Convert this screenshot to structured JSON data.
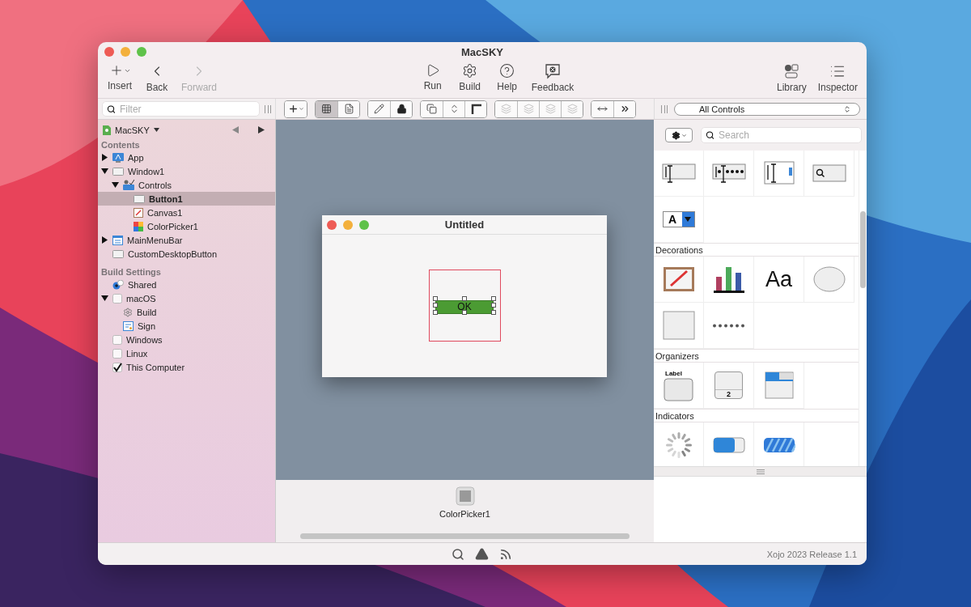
{
  "window": {
    "title": "MacSKY"
  },
  "toolbar": {
    "left": [
      {
        "kind": "insert",
        "label": "Insert",
        "disabled": false
      },
      {
        "kind": "back",
        "label": "Back",
        "disabled": false
      },
      {
        "kind": "forward",
        "label": "Forward",
        "disabled": true
      }
    ],
    "center": [
      {
        "kind": "run",
        "label": "Run",
        "disabled": false
      },
      {
        "kind": "build",
        "label": "Build",
        "disabled": false
      },
      {
        "kind": "help",
        "label": "Help",
        "disabled": false
      },
      {
        "kind": "feedback",
        "label": "Feedback",
        "disabled": false
      }
    ],
    "right": [
      {
        "kind": "library",
        "label": "Library",
        "disabled": false
      },
      {
        "kind": "inspector",
        "label": "Inspector",
        "disabled": false
      }
    ]
  },
  "filter": {
    "placeholder": "Filter"
  },
  "layout_tools": [
    [
      {
        "kind": "add",
        "pressed": false,
        "disabled": false
      }
    ],
    [
      {
        "kind": "grid",
        "pressed": true,
        "disabled": false
      },
      {
        "kind": "doc",
        "pressed": false,
        "disabled": false
      }
    ],
    [
      {
        "kind": "pencil",
        "pressed": false,
        "disabled": false
      },
      {
        "kind": "lock",
        "pressed": false,
        "disabled": false
      }
    ],
    [
      {
        "kind": "front",
        "pressed": false,
        "disabled": false
      },
      {
        "kind": "swap",
        "pressed": false,
        "disabled": false
      },
      {
        "kind": "corner",
        "pressed": false,
        "disabled": false
      }
    ],
    [
      {
        "kind": "align",
        "pressed": false,
        "disabled": true
      },
      {
        "kind": "align",
        "pressed": false,
        "disabled": true
      },
      {
        "kind": "align",
        "pressed": false,
        "disabled": true
      },
      {
        "kind": "align",
        "pressed": false,
        "disabled": true
      }
    ],
    [
      {
        "kind": "width",
        "pressed": false,
        "disabled": false
      },
      {
        "kind": "more",
        "pressed": false,
        "disabled": false
      }
    ]
  ],
  "navigator": {
    "project": "MacSKY",
    "sections": [
      {
        "title": "Contents",
        "items": [
          {
            "label": "App",
            "kind": "app",
            "expanded": false,
            "selected": false
          },
          {
            "label": "Window1",
            "kind": "window",
            "expanded": true,
            "selected": false,
            "children": [
              {
                "label": "Controls",
                "kind": "controls",
                "expanded": true,
                "selected": false,
                "children": [
                  {
                    "label": "Button1",
                    "kind": "window",
                    "selected": true
                  },
                  {
                    "label": "Canvas1",
                    "kind": "canvas",
                    "selected": false
                  },
                  {
                    "label": "ColorPicker1",
                    "kind": "colorpicker",
                    "selected": false
                  }
                ]
              }
            ]
          },
          {
            "label": "MainMenuBar",
            "kind": "menubar",
            "expanded": false,
            "selected": false
          },
          {
            "label": "CustomDesktopButton",
            "kind": "window",
            "selected": false
          }
        ]
      },
      {
        "title": "Build Settings",
        "items": [
          {
            "label": "Shared",
            "kind": "radio",
            "selected": false
          },
          {
            "label": "macOS",
            "kind": "checkbox",
            "checked": false,
            "expanded": true,
            "selected": false,
            "children": [
              {
                "label": "Build",
                "kind": "gear",
                "selected": false
              },
              {
                "label": "Sign",
                "kind": "sign",
                "selected": false
              }
            ]
          },
          {
            "label": "Windows",
            "kind": "checkbox",
            "checked": false,
            "selected": false
          },
          {
            "label": "Linux",
            "kind": "checkbox",
            "checked": false,
            "selected": false
          },
          {
            "label": "This Computer",
            "kind": "checkbox",
            "checked": true,
            "selected": false
          }
        ]
      }
    ]
  },
  "designer": {
    "window_title": "Untitled",
    "button_label": "OK",
    "tray": [
      {
        "label": "ColorPicker1"
      }
    ]
  },
  "library": {
    "filter": "All Controls",
    "search": {
      "placeholder": "Search"
    },
    "sections": [
      {
        "items": [
          {
            "kind": "textfield"
          },
          {
            "kind": "password"
          },
          {
            "kind": "textarea"
          },
          {
            "kind": "searchfield"
          },
          {
            "kind": "combobox",
            "text": "A"
          }
        ]
      },
      {
        "title": "Decorations",
        "items": [
          {
            "kind": "canvas"
          },
          {
            "kind": "chart"
          },
          {
            "kind": "label",
            "text": "Aa"
          },
          {
            "kind": "oval"
          },
          {
            "kind": "rectangle"
          },
          {
            "kind": "separator"
          }
        ]
      },
      {
        "title": "Organizers",
        "items": [
          {
            "kind": "groupbox",
            "text": "Label"
          },
          {
            "kind": "pagepanel",
            "text": "2"
          },
          {
            "kind": "tabpanel"
          }
        ]
      },
      {
        "title": "Indicators",
        "items": [
          {
            "kind": "spinner"
          },
          {
            "kind": "progress"
          },
          {
            "kind": "barberpole"
          }
        ]
      }
    ]
  },
  "status_bar": {
    "version": "Xojo 2023 Release 1.1"
  }
}
